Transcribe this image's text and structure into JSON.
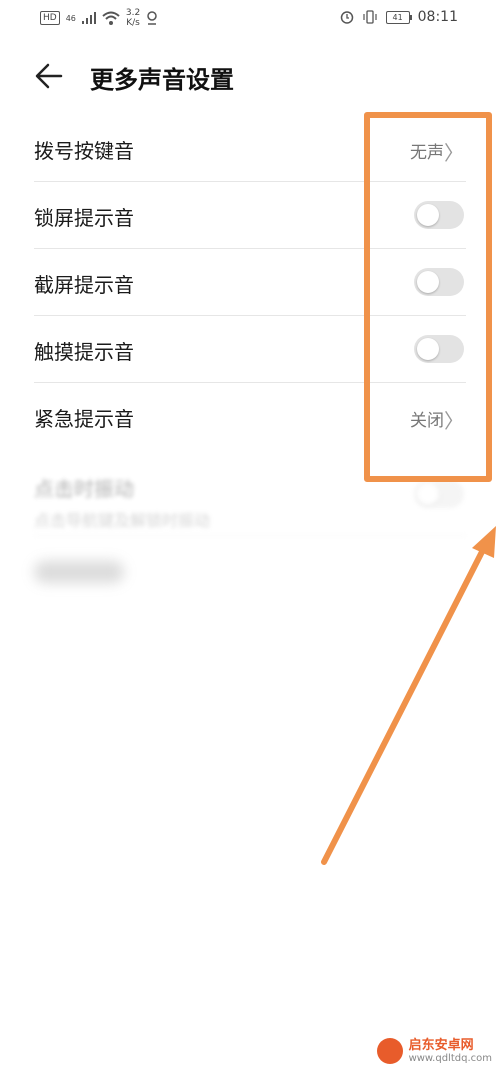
{
  "status_bar": {
    "hd": "HD",
    "network": "46",
    "speed_value": "3.2",
    "speed_unit": "K/s",
    "battery": "41",
    "time": "08:11"
  },
  "header": {
    "title": "更多声音设置"
  },
  "settings": [
    {
      "label": "拨号按键音",
      "type": "value",
      "value": "无声"
    },
    {
      "label": "锁屏提示音",
      "type": "toggle",
      "on": false
    },
    {
      "label": "截屏提示音",
      "type": "toggle",
      "on": false
    },
    {
      "label": "触摸提示音",
      "type": "toggle",
      "on": false
    },
    {
      "label": "紧急提示音",
      "type": "value",
      "value": "关闭"
    }
  ],
  "blurred_settings": [
    {
      "label": "点击时振动",
      "sublabel": "点击导航键及解锁时振动",
      "type": "toggle",
      "on": false
    }
  ],
  "watermark": {
    "name": "启东安卓网",
    "url": "www.qdltdq.com"
  },
  "colors": {
    "highlight": "#f0924a",
    "toggle_off": "#e3e3e3",
    "watermark": "#e85c2b"
  }
}
